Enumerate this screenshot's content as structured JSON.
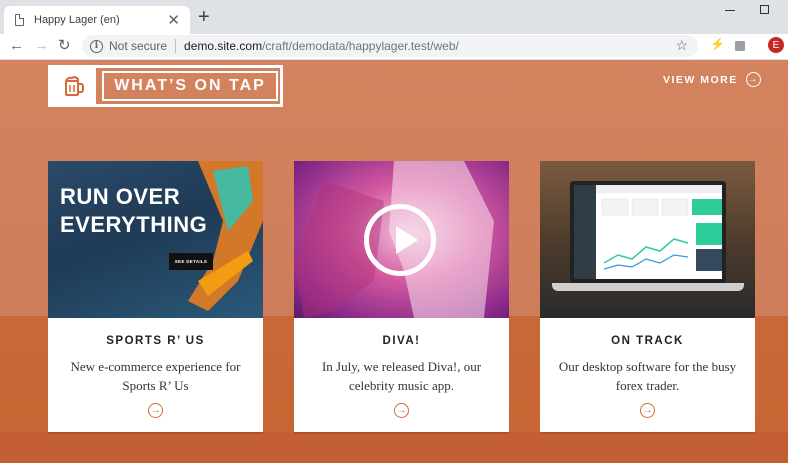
{
  "browser": {
    "tab_title": "Happy Lager (en)",
    "tab_close": "✕",
    "new_tab": "+",
    "not_secure": "Not secure",
    "url_host": "demo.site.com",
    "url_path": "/craft/demodata/happylager.test/web/",
    "profile_initial": "E"
  },
  "section": {
    "title": "WHAT’S ON TAP",
    "view_more": "VIEW MORE"
  },
  "cards": [
    {
      "title": "SPORTS R’ US",
      "description": "New e-commerce experience for Sports R’ Us",
      "thumb_headline": "RUN OVER EVERYTHING",
      "thumb_button": "SEE DETAILS"
    },
    {
      "title": "DIVA!",
      "description": "In July, we released Diva!, our celebrity music app."
    },
    {
      "title": "ON TRACK",
      "description": "Our desktop software for the busy forex trader."
    }
  ],
  "colors": {
    "page_bg_top": "#d4835f",
    "page_bg_bottom": "#c86838",
    "accent": "#d26a3c"
  }
}
